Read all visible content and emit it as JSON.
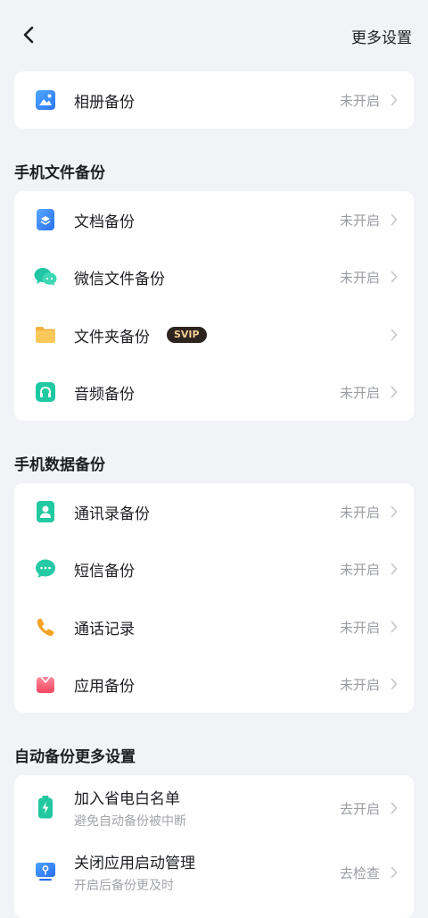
{
  "header": {
    "more_settings": "更多设置"
  },
  "album": {
    "label": "相册备份",
    "status": "未开启"
  },
  "file_section": {
    "title": "手机文件备份",
    "items": [
      {
        "label": "文档备份",
        "status": "未开启",
        "icon": "document-icon"
      },
      {
        "label": "微信文件备份",
        "status": "未开启",
        "icon": "wechat-icon"
      },
      {
        "label": "文件夹备份",
        "status": "",
        "badge": "SVIP",
        "icon": "folder-icon"
      },
      {
        "label": "音频备份",
        "status": "未开启",
        "icon": "headphones-icon"
      }
    ]
  },
  "data_section": {
    "title": "手机数据备份",
    "items": [
      {
        "label": "通讯录备份",
        "status": "未开启",
        "icon": "contacts-icon"
      },
      {
        "label": "短信备份",
        "status": "未开启",
        "icon": "message-icon"
      },
      {
        "label": "通话记录",
        "status": "未开启",
        "icon": "phone-icon"
      },
      {
        "label": "应用备份",
        "status": "未开启",
        "icon": "app-icon"
      }
    ]
  },
  "auto_section": {
    "title": "自动备份更多设置",
    "items": [
      {
        "label": "加入省电白名单",
        "sub": "避免自动备份被中断",
        "status": "去开启",
        "icon": "battery-icon"
      },
      {
        "label": "关闭应用启动管理",
        "sub": "开启后备份更及时",
        "status": "去检查",
        "icon": "startup-manager-icon"
      }
    ]
  },
  "colors": {
    "background": "#f2f3f6",
    "card": "#ffffff",
    "status_text": "#9a9ca3",
    "badge_bg": "#2d231f",
    "badge_text": "#f2cf96"
  }
}
